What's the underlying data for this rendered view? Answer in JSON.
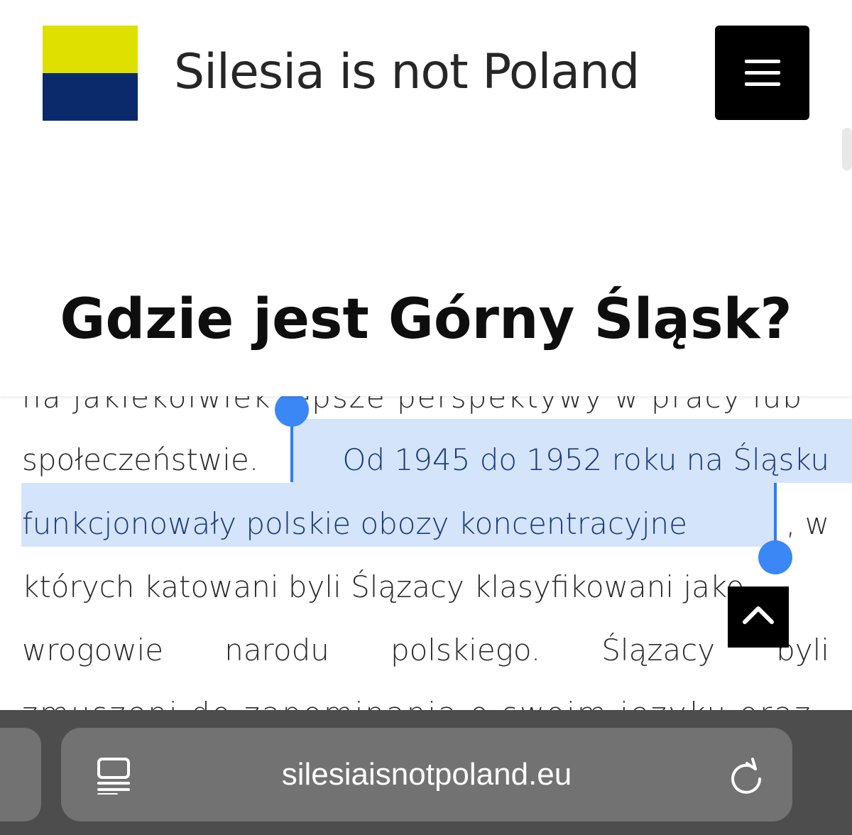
{
  "header": {
    "site_title": "Silesia is not Poland",
    "menu_icon": "hamburger-menu-icon",
    "flag_colors": [
      "#dfe000",
      "#0a2a6b"
    ]
  },
  "page": {
    "title": "Gdzie jest Górny Śląsk?"
  },
  "article": {
    "line0": "na jakiekolwiek lepsze perspektywy w pracy lub",
    "line1_a": "społeczeństwie.",
    "line1_b": "Od 1945 do 1952 roku na Śląsku",
    "line2_sel": "funkcjonowały polskie obozy koncentracyjne",
    "line2_rest": ", w",
    "line3": "których katowani byli Ślązacy klasyfikowani jako",
    "line4_words": [
      "wrogowie",
      "narodu",
      "polskiego.",
      "Ślązacy",
      "byli"
    ],
    "line5": "zmuszeni do zapominania o swoim języku oraz",
    "selection_color": "#d4e4fb",
    "handle_color": "#3b87f6"
  },
  "back_to_top": {
    "icon": "chevron-up-icon"
  },
  "browser": {
    "url": "silesiaisnotpoland.eu",
    "reader_icon": "reader-mode-icon",
    "reload_icon": "reload-icon"
  }
}
